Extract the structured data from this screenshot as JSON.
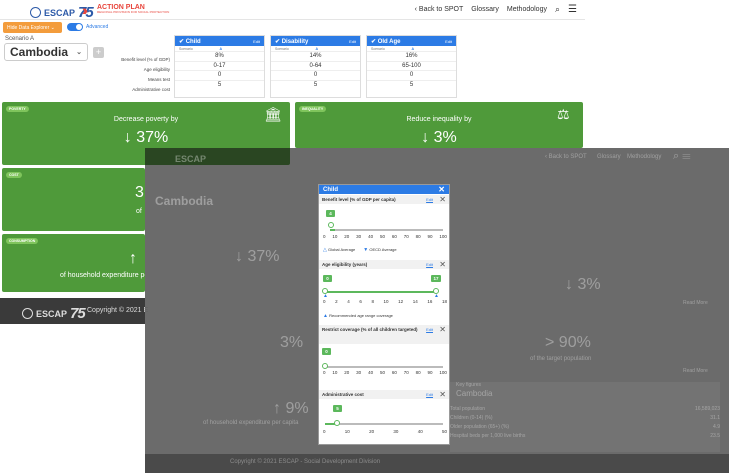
{
  "header": {
    "logo_text": "ESCAP",
    "logo_num": "75",
    "action_plan": "ACTION PLAN",
    "action_plan_sub": "REGIONAL PROVISION FOR SOCIAL PROTECTION",
    "back": "‹ Back to SPOT",
    "glossary": "Glossary",
    "methodology": "Methodology"
  },
  "controls": {
    "hide_btn": "Hide Data Explorer ⌄",
    "advanced": "Advanced",
    "scenario": "Scenario A",
    "country": "Cambodia"
  },
  "rows": {
    "benefit": "Benefit level (% of GDP)",
    "age": "Age eligibility",
    "means": "Means test",
    "admin": "Administrative cost"
  },
  "cards": [
    {
      "title": "✔ Child",
      "edit": "Edit",
      "sub": "Scenario",
      "a": "A",
      "values": [
        "8%",
        "0-17",
        "0",
        "5"
      ]
    },
    {
      "title": "✔ Disability",
      "edit": "Edit",
      "sub": "Scenario",
      "a": "A",
      "values": [
        "14%",
        "0-64",
        "0",
        "5"
      ]
    },
    {
      "title": "✔ Old Age",
      "edit": "Edit",
      "sub": "Scenario",
      "a": "A",
      "values": [
        "16%",
        "65-100",
        "0",
        "5"
      ]
    }
  ],
  "panels": {
    "poverty": {
      "tag": "POVERTY",
      "text": "Decrease poverty by",
      "value": "↓ 37%"
    },
    "inequality": {
      "tag": "INEQUALITY",
      "text": "Reduce inequality by",
      "value": "↓ 3%"
    },
    "cost": {
      "tag": "COST",
      "value_part": "3",
      "text_part": "of"
    },
    "consumption": {
      "tag": "CONSUMPTION",
      "value": "↑",
      "text": "of household expenditure pe"
    }
  },
  "footer": {
    "copyright": "Copyright © 2021 E",
    "copyright_full": "Copyright © 2021 ESCAP - Social Development Division"
  },
  "overlay": {
    "back": "‹ Back to SPOT",
    "glossary": "Glossary",
    "methodology": "Methodology",
    "hide_btn": "Hide Data Explorer",
    "poverty_value": "↓ 37%",
    "ineq_value": "↓ 3%",
    "cost_value": "3%",
    "cov_value": "> 90%",
    "cov_text": "of the target population",
    "cons_value": "↑ 9%",
    "cons_text": "of household expenditure per capita",
    "read_more": "Read More",
    "table_title": "Cambodia",
    "table_head": "Key figures",
    "table_rows": [
      [
        "Total population",
        "16,589,023"
      ],
      [
        "Children (0-14) (%)",
        "31.1"
      ],
      [
        "Older population (65+) (%)",
        "4.9"
      ],
      [
        "Hospital beds per 1,000 live births",
        "23.5"
      ]
    ],
    "card_values": [
      "14%",
      "0-64",
      "0",
      "5",
      "16%",
      "65-100",
      "0",
      "5"
    ]
  },
  "modal": {
    "title": "Child",
    "benefit": {
      "label": "Benefit level (% of GDP per capita)",
      "edit": "Edit",
      "value": "4",
      "ticks": [
        "0",
        "10",
        "20",
        "30",
        "40",
        "50",
        "60",
        "70",
        "80",
        "90",
        "100"
      ],
      "leg1": "Global Average",
      "leg2": "OECD Average"
    },
    "age": {
      "label": "Age eligibility (years)",
      "edit": "Edit",
      "min": "0",
      "max": "17",
      "ticks": [
        "0",
        "2",
        "4",
        "6",
        "8",
        "10",
        "12",
        "14",
        "16",
        "18"
      ],
      "leg": "Recommended age range coverage"
    },
    "coverage": {
      "label": "Restrict coverage (% of all children targeted)",
      "edit": "Edit",
      "value": "0",
      "ticks": [
        "0",
        "10",
        "20",
        "30",
        "40",
        "50",
        "60",
        "70",
        "80",
        "90",
        "100"
      ]
    },
    "admin": {
      "label": "Administrative cost",
      "edit": "Edit",
      "value": "5",
      "ticks": [
        "0",
        "10",
        "20",
        "30",
        "40",
        "50"
      ]
    }
  }
}
